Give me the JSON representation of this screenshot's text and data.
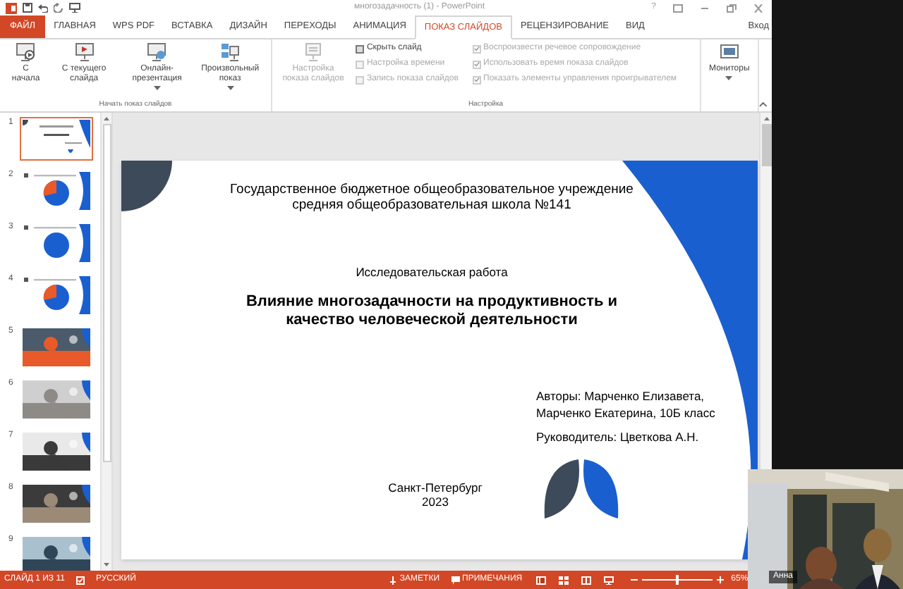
{
  "window": {
    "title": "многозадачность (1) - PowerPoint",
    "help": "?",
    "sign_in": "Вход"
  },
  "tabs": [
    {
      "label": "ФАЙЛ",
      "kind": "file",
      "selected": false
    },
    {
      "label": "ГЛАВНАЯ",
      "kind": "tab",
      "selected": false
    },
    {
      "label": "WPS PDF",
      "kind": "tab",
      "selected": false
    },
    {
      "label": "ВСТАВКА",
      "kind": "tab",
      "selected": false
    },
    {
      "label": "ДИЗАЙН",
      "kind": "tab",
      "selected": false
    },
    {
      "label": "ПЕРЕХОДЫ",
      "kind": "tab",
      "selected": false
    },
    {
      "label": "АНИМАЦИЯ",
      "kind": "tab",
      "selected": false
    },
    {
      "label": "ПОКАЗ СЛАЙДОВ",
      "kind": "tab",
      "selected": true
    },
    {
      "label": "РЕЦЕНЗИРОВАНИЕ",
      "kind": "tab",
      "selected": false
    },
    {
      "label": "ВИД",
      "kind": "tab",
      "selected": false
    }
  ],
  "ribbon": {
    "groups": [
      {
        "label": "Начать показ слайдов",
        "buttons": [
          {
            "label": "С начала",
            "dropdown": false
          },
          {
            "label": "С текущего слайда",
            "dropdown": false
          },
          {
            "label": "Онлайн-презентация",
            "dropdown": true
          },
          {
            "label": "Произвольный показ",
            "dropdown": true
          }
        ]
      },
      {
        "label": "Настройка",
        "big_button": {
          "label": "Настройка показа слайдов",
          "disabled": true
        },
        "small_buttons": [
          {
            "label": "Скрыть слайд",
            "disabled": false
          },
          {
            "label": "Настройка времени",
            "disabled": true
          },
          {
            "label": "Запись показа слайдов",
            "disabled": true
          }
        ],
        "checkboxes": [
          {
            "label": "Воспроизвести речевое сопровождение",
            "checked": true
          },
          {
            "label": "Использовать время показа слайдов",
            "checked": true
          },
          {
            "label": "Показать элементы управления проигрывателем",
            "checked": true
          }
        ]
      },
      {
        "buttons": [
          {
            "label": "Мониторы",
            "dropdown": true
          }
        ]
      }
    ]
  },
  "thumbnails": [
    {
      "number": "1",
      "kind": "title",
      "selected": true
    },
    {
      "number": "2",
      "kind": "chart",
      "selected": false
    },
    {
      "number": "3",
      "kind": "chart",
      "selected": false
    },
    {
      "number": "4",
      "kind": "chart",
      "selected": false
    },
    {
      "number": "5",
      "kind": "picture",
      "selected": false
    },
    {
      "number": "6",
      "kind": "picture",
      "selected": false
    },
    {
      "number": "7",
      "kind": "picture",
      "selected": false
    },
    {
      "number": "8",
      "kind": "picture",
      "selected": false
    },
    {
      "number": "9",
      "kind": "picture",
      "selected": false
    }
  ],
  "slide": {
    "school": "Государственное бюджетное общеобразовательное учреждение средняя общеобразовательная школа №141",
    "type": "Исследовательская работа",
    "heading": "Влияние многозадачности на продуктивность и качество человеческой деятельности",
    "authors": "Авторы: Марченко Елизавета, Марченко Екатерина, 10Б класс",
    "supervisor": "Руководитель: Цветкова А.Н.",
    "city": "Санкт-Петербург",
    "year": "2023"
  },
  "status_bar": {
    "slide": "СЛАЙД 1 ИЗ 11",
    "language": "РУССКИЙ",
    "notes": "ЗАМЕТКИ",
    "comments": "ПРИМЕЧАНИЯ",
    "zoom": "65%",
    "level": 0.5
  },
  "video": {
    "name": "Анна"
  }
}
